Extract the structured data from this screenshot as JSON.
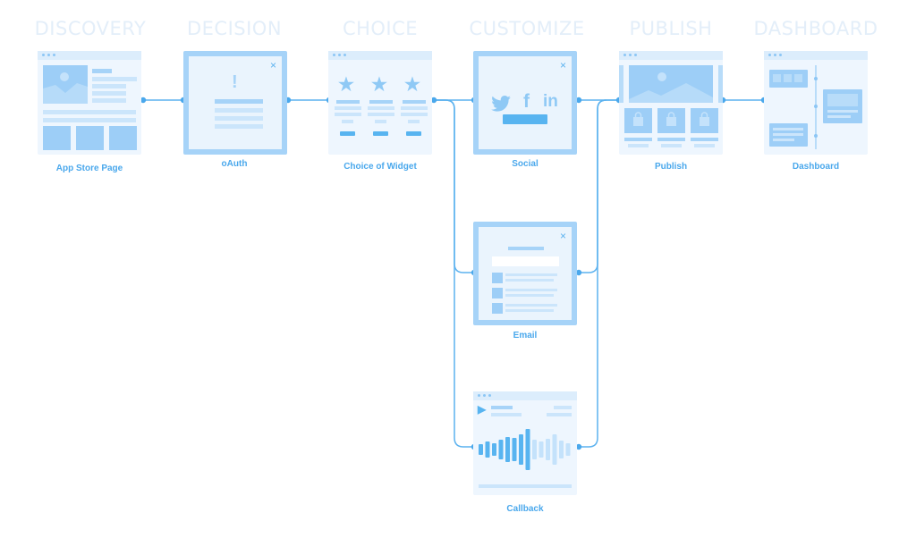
{
  "columns": [
    {
      "title": "DISCOVERY"
    },
    {
      "title": "DECISION"
    },
    {
      "title": "CHOICE"
    },
    {
      "title": "CUSTOMIZE"
    },
    {
      "title": "PUBLISH"
    },
    {
      "title": "DASHBOARD"
    }
  ],
  "nodes": {
    "app_store_page": {
      "label": "App Store Page"
    },
    "oauth": {
      "label": "oAuth",
      "icon": "exclamation-icon",
      "glyph": "!"
    },
    "choice_of_widget": {
      "label": "Choice of Widget",
      "icon": "star-icon",
      "glyph": "★"
    },
    "social": {
      "label": "Social",
      "icons": [
        "twitter-icon",
        "facebook-icon",
        "linkedin-icon"
      ],
      "facebook_glyph": "f",
      "linkedin_glyph": "in"
    },
    "email": {
      "label": "Email"
    },
    "callback": {
      "label": "Callback",
      "icon": "play-icon",
      "glyph": "▶"
    },
    "publish": {
      "label": "Publish",
      "icon": "shopping-bag-icon"
    },
    "dashboard": {
      "label": "Dashboard"
    }
  },
  "close_glyph": "×",
  "colors": {
    "accent": "#4aa8ec",
    "line": "#5cb2ef",
    "card_bg": "#eaf4fd",
    "card_border": "#a6d3f8",
    "title_faint": "#e3eef9"
  },
  "connections": [
    [
      "app_store_page",
      "oauth"
    ],
    [
      "oauth",
      "choice_of_widget"
    ],
    [
      "choice_of_widget",
      "social"
    ],
    [
      "choice_of_widget",
      "email"
    ],
    [
      "choice_of_widget",
      "callback"
    ],
    [
      "social",
      "publish"
    ],
    [
      "email",
      "publish"
    ],
    [
      "callback",
      "publish"
    ],
    [
      "publish",
      "dashboard"
    ]
  ]
}
